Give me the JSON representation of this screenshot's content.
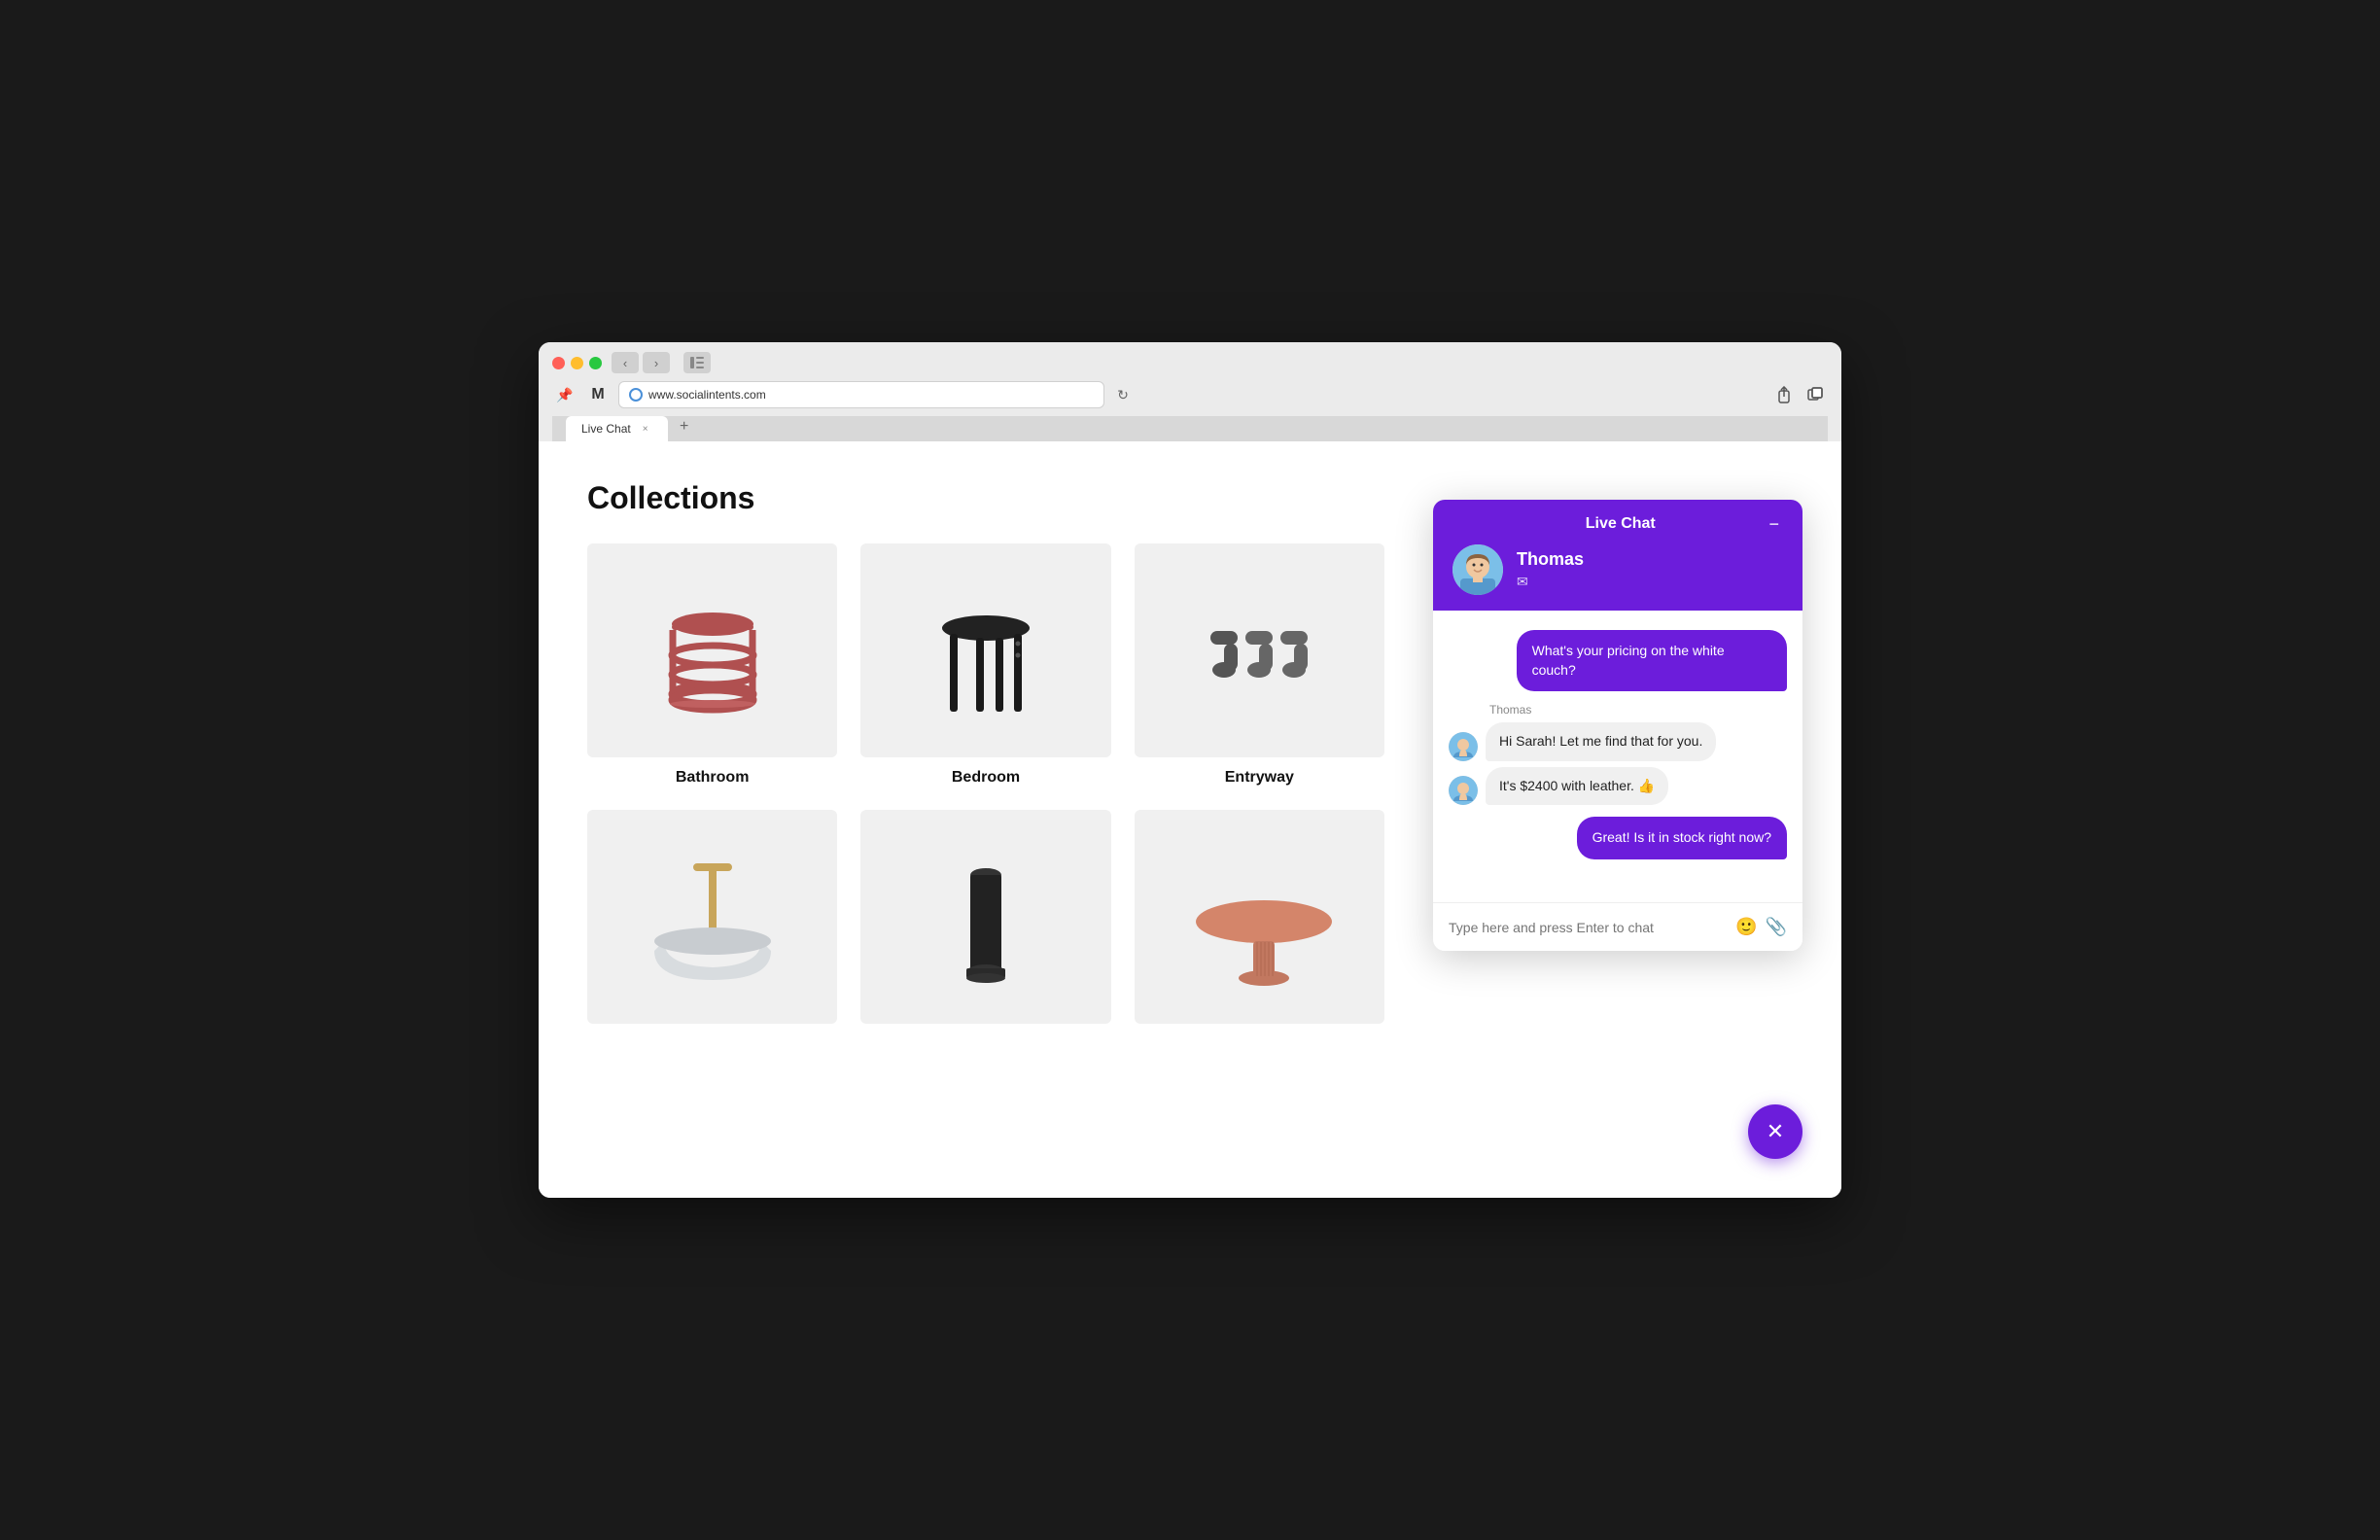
{
  "browser": {
    "url": "www.socialintents.com",
    "tab_title": "Live Chat",
    "new_tab_label": "+"
  },
  "page": {
    "title": "Collections",
    "products": [
      {
        "id": "bathroom",
        "label": "Bathroom",
        "type": "stool-red"
      },
      {
        "id": "bedroom",
        "label": "Bedroom",
        "type": "stool-black"
      },
      {
        "id": "entryway",
        "label": "Entryway",
        "type": "hooks"
      },
      {
        "id": "bowl",
        "label": "",
        "type": "bowl-wood"
      },
      {
        "id": "cylinder",
        "label": "",
        "type": "cylinder-black"
      },
      {
        "id": "table",
        "label": "",
        "type": "table-copper"
      }
    ]
  },
  "chat": {
    "header_title": "Live Chat",
    "agent_name": "Thomas",
    "minimize_label": "−",
    "messages": [
      {
        "id": "msg1",
        "type": "outgoing",
        "text": "What's your pricing on the white couch?"
      },
      {
        "id": "msg2",
        "type": "incoming",
        "sender": "Thomas",
        "text": "Hi Sarah! Let me find that for you."
      },
      {
        "id": "msg3",
        "type": "incoming",
        "sender": "Thomas",
        "text": "It's $2400 with leather. 👍"
      },
      {
        "id": "msg4",
        "type": "outgoing",
        "text": "Great! Is it in stock right now?"
      }
    ],
    "input_placeholder": "Type here and press Enter to chat"
  },
  "colors": {
    "accent": "#6c1ddb",
    "outgoing_bubble": "#6c1ddb",
    "incoming_bubble": "#f0f0f0"
  }
}
